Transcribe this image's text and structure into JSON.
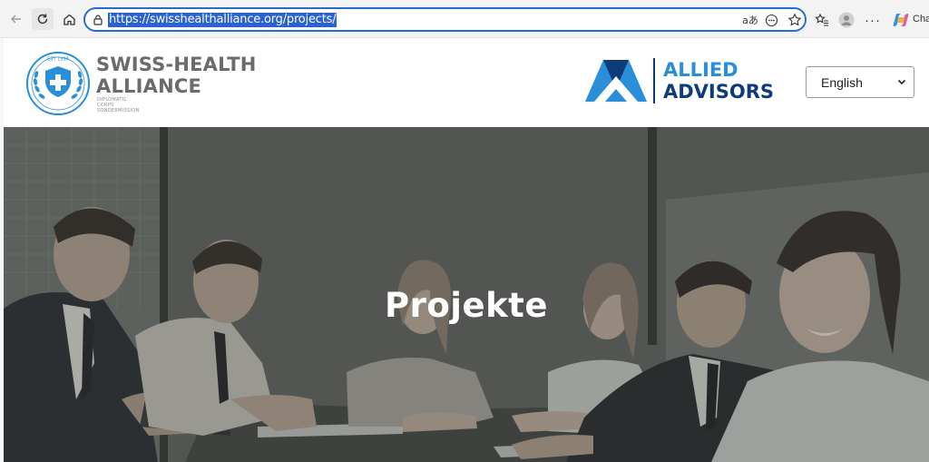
{
  "browser": {
    "url": "https://swisshealthalliance.org/projects/",
    "translate_glyph": "aあ",
    "menu_glyph": "···",
    "copilot_label": "Cha"
  },
  "header": {
    "sha_logo": {
      "badge_text": "EST 1994",
      "name_line1": "SWISS-HEALTH",
      "name_line2": "ALLIANCE",
      "sub_lines": [
        "DIPLOMATIC",
        "CORPS",
        "SONDERMISSION"
      ]
    },
    "allied_logo": {
      "line1": "ALLIED",
      "line2": "ADVISORS"
    },
    "language": {
      "selected": "English"
    }
  },
  "hero": {
    "title": "Projekte"
  },
  "colors": {
    "url_highlight": "#2a62d2",
    "address_border": "#2a6bd3",
    "sha_blue": "#2a8fd8",
    "allied_light": "#2a8fd8",
    "allied_dark": "#0e3b7a",
    "hero_overlay": "#595d58"
  }
}
